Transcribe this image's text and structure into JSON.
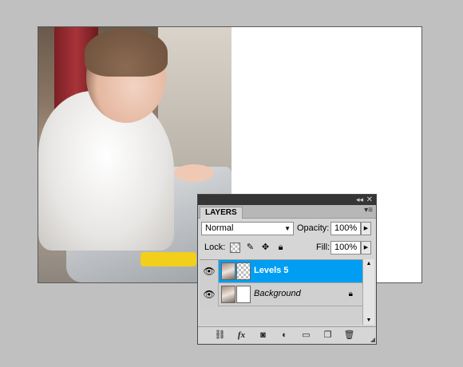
{
  "panel": {
    "tab_label": "LAYERS",
    "blend_mode": "Normal",
    "opacity_label": "Opacity:",
    "opacity_value": "100%",
    "lock_label": "Lock:",
    "fill_label": "Fill:",
    "fill_value": "100%",
    "layers": [
      {
        "name": "Levels 5",
        "selected": true,
        "type": "adjustment"
      },
      {
        "name": "Background",
        "selected": false,
        "type": "background",
        "locked": true
      }
    ],
    "footer_icons": [
      "link-layers-icon",
      "fx-icon",
      "add-mask-icon",
      "adjustment-layer-icon",
      "new-group-icon",
      "new-layer-icon",
      "trash-icon"
    ]
  },
  "colors": {
    "selection": "#009ef2",
    "panel_bg": "#d6d6d6",
    "workspace_bg": "#c0c0c0"
  }
}
